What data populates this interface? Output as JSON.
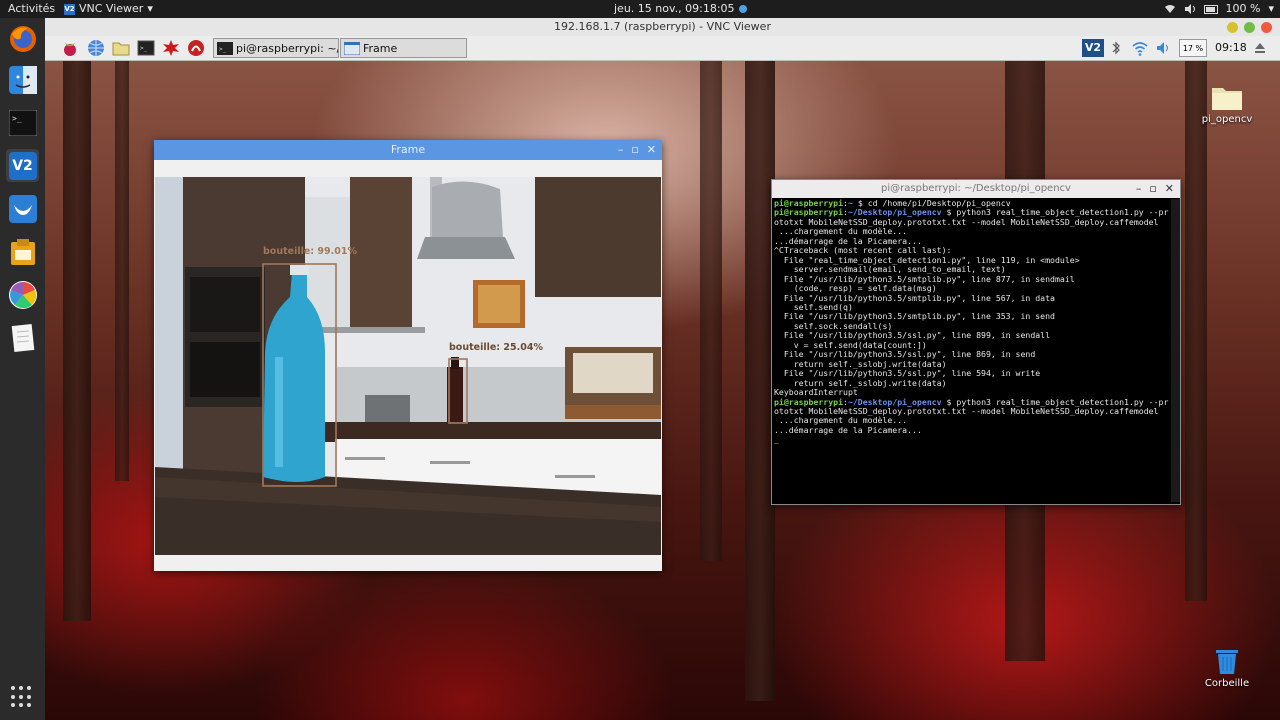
{
  "topbar": {
    "activities": "Activités",
    "app_menu": "VNC Viewer",
    "app_menu_arrow": "▾",
    "clock": "jeu. 15 nov., 09:18:05",
    "battery": "100 %",
    "dropdown": "▾"
  },
  "dock": {
    "items": [
      {
        "name": "firefox-icon"
      },
      {
        "name": "finder-icon"
      },
      {
        "name": "terminal-icon"
      },
      {
        "name": "vnc-viewer-icon"
      },
      {
        "name": "mail-icon"
      },
      {
        "name": "installer-icon"
      },
      {
        "name": "photos-icon"
      },
      {
        "name": "notes-icon"
      }
    ]
  },
  "vnc": {
    "title": "192.168.1.7 (raspberrypi) - VNC Viewer",
    "colors": {
      "close": "#f05a3c",
      "min": "#d6c22d",
      "max": "#6fbd45"
    }
  },
  "pi_panel": {
    "tasks": [
      {
        "label": "pi@raspberrypi: ~/De..."
      },
      {
        "label": "Frame"
      }
    ],
    "cpu": "17 %",
    "time": "09:18"
  },
  "desktop": {
    "icons": [
      {
        "label": "pi_opencv"
      },
      {
        "label": "Corbeille"
      }
    ]
  },
  "frame_window": {
    "title": "Frame",
    "detections": [
      {
        "label": "bouteille: 99.01%"
      },
      {
        "label": "bouteille: 25.04%"
      }
    ],
    "box_color": "#a0785a"
  },
  "terminal": {
    "title": "pi@raspberrypi: ~/Desktop/pi_opencv",
    "prompt_user": "pi@raspberrypi",
    "path_home": "~",
    "path_proj": "~/Desktop/pi_opencv",
    "cmd1": "cd /home/pi/Desktop/pi_opencv",
    "cmd2_a": "python3 real_time_object_detection1.py --pr",
    "cmd2_b": "ototxt MobileNetSSD_deploy.prototxt.txt --model MobileNetSSD_deploy.caffemodel",
    "output": [
      " ...chargement du modèle...",
      "...démarrage de la Picamera...",
      "^CTraceback (most recent call last):",
      "  File \"real_time_object_detection1.py\", line 119, in <module>",
      "    server.sendmail(email, send_to_email, text)",
      "  File \"/usr/lib/python3.5/smtplib.py\", line 877, in sendmail",
      "    (code, resp) = self.data(msg)",
      "  File \"/usr/lib/python3.5/smtplib.py\", line 567, in data",
      "    self.send(q)",
      "  File \"/usr/lib/python3.5/smtplib.py\", line 353, in send",
      "    self.sock.sendall(s)",
      "  File \"/usr/lib/python3.5/ssl.py\", line 899, in sendall",
      "    v = self.send(data[count:])",
      "  File \"/usr/lib/python3.5/ssl.py\", line 869, in send",
      "    return self._sslobj.write(data)",
      "  File \"/usr/lib/python3.5/ssl.py\", line 594, in write",
      "    return self._sslobj.write(data)",
      "KeyboardInterrupt"
    ],
    "output2": [
      " ...chargement du modèle...",
      "...démarrage de la Picamera..."
    ],
    "cursor": "_"
  }
}
